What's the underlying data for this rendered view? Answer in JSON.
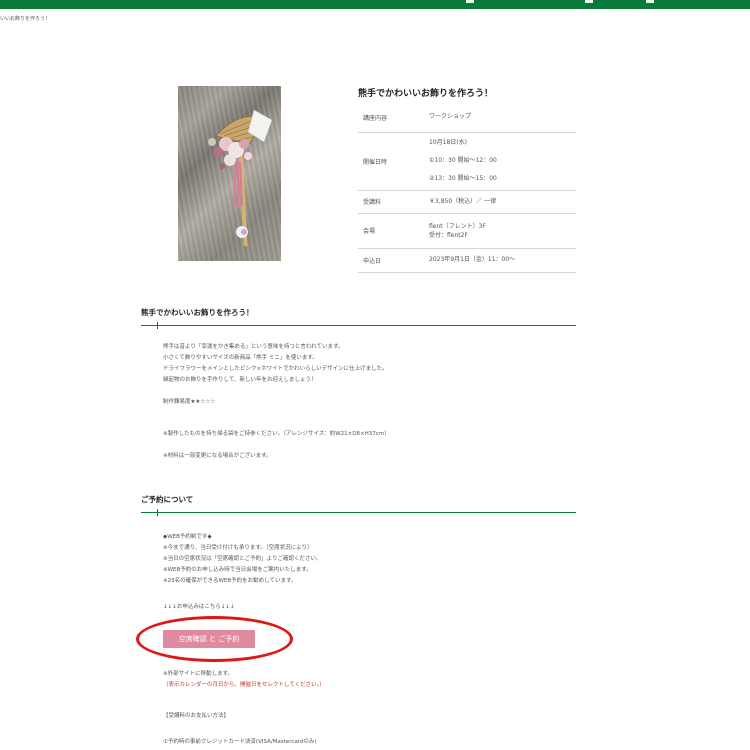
{
  "header": {
    "breadcrumb": "いいお飾りを作ろう！"
  },
  "workshop": {
    "title": "熊手でかわいいお飾りを作ろう！",
    "rows": [
      {
        "label": "講座内容",
        "values": [
          "ワークショップ"
        ]
      },
      {
        "label": "開催日時",
        "values": [
          "10月18日(水)",
          "①10：30 開始～12：00",
          "②13：30 開始～15：00"
        ]
      },
      {
        "label": "受講料",
        "values": [
          "￥3,850（税込）／ 一律"
        ]
      },
      {
        "label": "会場",
        "values": [
          "flent（フレント）3F",
          "受付：flent2F"
        ]
      },
      {
        "label": "申込日",
        "values": [
          "2023年9月1日（金）11：00～"
        ]
      }
    ]
  },
  "section1": {
    "title": "熊手でかわいいお飾りを作ろう！",
    "lines": [
      "熊手は昔より「幸運をかき集める」という意味を持つと言われています。",
      "小さくて飾りやすいサイズの新商品「熊手 ミニ」を使います。",
      "ドライフラワーをメインとしたピンク×ホワイトでかわいらしいデザインに仕上げました。",
      "縁起物のお飾りを手作りして、新しい年をお迎えしましょう！",
      "制作難易度★★☆☆☆",
      "※製作したものを持ち帰る袋をご持参ください。（アレンジサイズ：約W21×D8×H37cm）",
      "※材料は一部変更になる場合がございます。"
    ]
  },
  "section2": {
    "title": "ご予約について",
    "lines": [
      "◆WEB予約制です◆",
      "※今まで通り、当日受け付けも承ります。（空席状況により）",
      "※当日の空席状況は「空席確認とご予約」よりご確認ください。",
      "※WEB予約のお申し込み時で当日会場をご案内いたします。",
      "※23名の確保ができるWEB予約をお勧めしています。"
    ],
    "arrow_text": "↓↓↓お申込みはこちら↓↓↓",
    "button_label": "空席確認 と ご予約",
    "note1": "※外部サイトに移動します。",
    "note2": "（表示カレンダーの月日から、開催日をセレクトしてください。）",
    "payment_title": "【受講料のお支払い方法】",
    "payment_line1": "①予約時の事前クレジットカード決済(VISA/Mastercardのみ)"
  },
  "colors": {
    "brand_green": "#0a7a3a",
    "button_pink": "#df8aa0",
    "highlight_red": "#e01515"
  }
}
